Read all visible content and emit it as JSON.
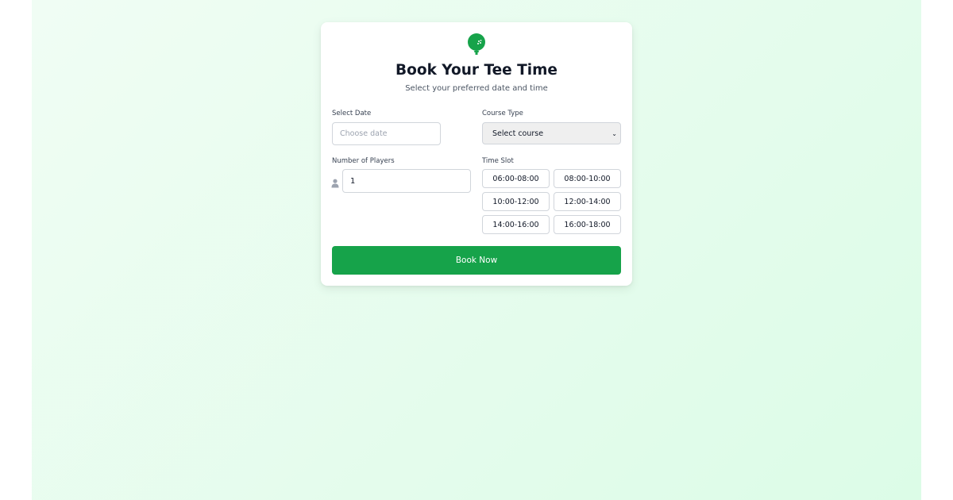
{
  "header": {
    "title": "Book Your Tee Time",
    "subtitle": "Select your preferred date and time",
    "logo_icon": "golf-ball-icon"
  },
  "form": {
    "date": {
      "label": "Select Date",
      "placeholder": "Choose date",
      "value": ""
    },
    "course": {
      "label": "Course Type",
      "selected": "Select course"
    },
    "players": {
      "label": "Number of Players",
      "value": "1",
      "icon": "person-icon"
    },
    "time_slot": {
      "label": "Time Slot",
      "options": [
        "06:00-08:00",
        "08:00-10:00",
        "10:00-12:00",
        "12:00-14:00",
        "14:00-16:00",
        "16:00-18:00"
      ]
    },
    "submit_label": "Book Now"
  },
  "colors": {
    "accent": "#16a34a",
    "background_start": "#f0fdf4",
    "background_end": "#dcfce7"
  }
}
